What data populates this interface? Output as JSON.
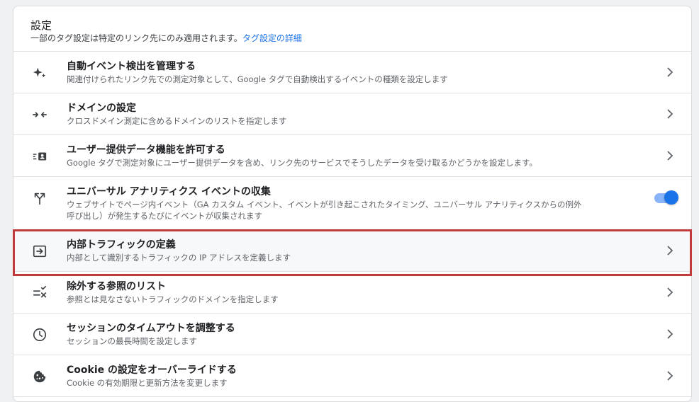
{
  "header": {
    "title": "設定",
    "subtitle": "一部のタグ設定は特定のリンク先にのみ適用されます。",
    "link": "タグ設定の詳細"
  },
  "rows": [
    {
      "title": "自動イベント検出を管理する",
      "desc": "関連付けられたリンク先での測定対象として、Google タグで自動検出するイベントの種類を設定します",
      "icon": "sparkle-icon",
      "control": "chevron"
    },
    {
      "title": "ドメインの設定",
      "desc": "クロスドメイン測定に含めるドメインのリストを指定します",
      "icon": "merge-arrows-icon",
      "control": "chevron"
    },
    {
      "title": "ユーザー提供データ機能を許可する",
      "desc": "Google タグで測定対象にユーザー提供データを含め、リンク先のサービスでそうしたデータを受け取るかどうかを設定します。",
      "icon": "user-data-icon",
      "control": "chevron"
    },
    {
      "title": "ユニバーサル アナリティクス イベントの収集",
      "desc1": "ウェブサイトでページ内イベント（GA カスタム イベント、イベントが引き起こされたタイミング、ユニバーサル アナリティクスからの例外",
      "desc2": "呼び出し）が発生するたびにイベントが収集されます",
      "icon": "fork-arrow-icon",
      "control": "toggle",
      "toggle_on": true
    },
    {
      "title": "内部トラフィックの定義",
      "desc": "内部として識別するトラフィックの IP アドレスを定義します",
      "icon": "sign-in-icon",
      "control": "chevron",
      "highlighted": true
    },
    {
      "title": "除外する参照のリスト",
      "desc": "参照とは見なさないトラフィックのドメインを指定します",
      "icon": "list-remove-icon",
      "control": "chevron"
    },
    {
      "title": "セッションのタイムアウトを調整する",
      "desc": "セッションの最長時間を設定します",
      "icon": "clock-icon",
      "control": "chevron"
    },
    {
      "title": "Cookie の設定をオーバーライドする",
      "desc": "Cookie の有効期限と更新方法を変更します",
      "icon": "cookie-icon",
      "control": "chevron"
    }
  ],
  "colors": {
    "accent": "#1a73e8",
    "highlight_border": "#c0393b"
  }
}
